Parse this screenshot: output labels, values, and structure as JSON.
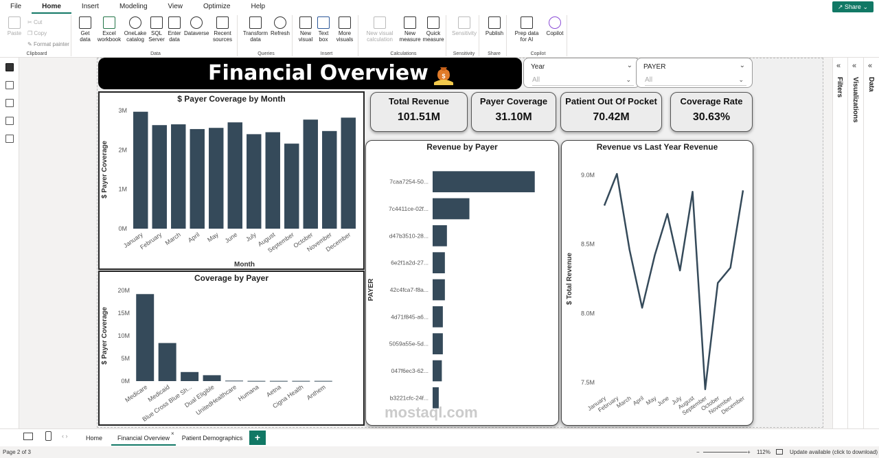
{
  "ribbon_tabs": [
    "File",
    "Home",
    "Insert",
    "Modeling",
    "View",
    "Optimize",
    "Help"
  ],
  "share_label": "Share",
  "ribbon": {
    "clipboard": {
      "paste": "Paste",
      "cut": "Cut",
      "copy": "Copy",
      "format_painter": "Format painter",
      "label": "Clipboard"
    },
    "data": {
      "get_data": "Get data",
      "excel": "Excel workbook",
      "onelake": "OneLake catalog",
      "sql": "SQL Server",
      "enter": "Enter data",
      "dataverse": "Dataverse",
      "recent": "Recent sources",
      "label": "Data"
    },
    "queries": {
      "transform": "Transform data",
      "refresh": "Refresh",
      "label": "Queries"
    },
    "insert": {
      "new_visual": "New visual",
      "text_box": "Text box",
      "more_visuals": "More visuals",
      "label": "Insert"
    },
    "calculations": {
      "new_visual_calc": "New visual calculation",
      "new_measure": "New measure",
      "quick_measure": "Quick measure",
      "label": "Calculations"
    },
    "sensitivity": {
      "sensitivity": "Sensitivity",
      "label": "Sensitivity"
    },
    "share": {
      "publish": "Publish",
      "label": "Share"
    },
    "copilot": {
      "prep_data": "Prep data for AI",
      "copilot": "Copilot",
      "label": "Copilot"
    }
  },
  "panes": {
    "filters": "Filters",
    "visualizations": "Visualizations",
    "data": "Data"
  },
  "report": {
    "title": "Financial Overview",
    "slicers": [
      {
        "title": "Year",
        "value": "All"
      },
      {
        "title": "PAYER",
        "value": "All"
      }
    ],
    "cards": [
      {
        "title": "Total Revenue",
        "value": "101.51M"
      },
      {
        "title": "Payer Coverage",
        "value": "31.10M"
      },
      {
        "title": "Patient Out Of Pocket",
        "value": "70.42M"
      },
      {
        "title": "Coverage Rate",
        "value": "30.63%"
      }
    ]
  },
  "chart_data": [
    {
      "type": "bar",
      "title": "$ Payer Coverage by Month",
      "xlabel": "Month",
      "ylabel": "$ Payer Coverage",
      "yticks": [
        "0M",
        "1M",
        "2M",
        "3M"
      ],
      "ylim": [
        0,
        3
      ],
      "categories": [
        "January",
        "February",
        "March",
        "April",
        "May",
        "June",
        "July",
        "August",
        "September",
        "October",
        "November",
        "December"
      ],
      "values": [
        2.97,
        2.63,
        2.65,
        2.53,
        2.56,
        2.7,
        2.4,
        2.45,
        2.16,
        2.77,
        2.48,
        2.82
      ],
      "color": "#354a5a"
    },
    {
      "type": "bar",
      "title": "Coverage by Payer",
      "ylabel": "$ Payer Coverage",
      "yticks": [
        "0M",
        "5M",
        "10M",
        "15M",
        "20M"
      ],
      "ylim": [
        0,
        20
      ],
      "categories": [
        "Medicare",
        "Medicaid",
        "Blue Cross Blue Sh...",
        "Dual Eligible",
        "UnitedHealthcare",
        "Humana",
        "Aetna",
        "Cigna Health",
        "Anthem"
      ],
      "values": [
        19.2,
        8.4,
        2.0,
        1.3,
        0.1,
        0.05,
        0.05,
        0.05,
        0.05
      ],
      "color": "#354a5a"
    },
    {
      "type": "bar",
      "orientation": "horizontal",
      "title": "Revenue by Payer",
      "ylabel": "PAYER",
      "categories": [
        "7caa7254-50...",
        "7c4411ce-02f...",
        "d47b3510-28...",
        "6e2f1a2d-27...",
        "42c4fca7-f8a...",
        "4d71f845-a6...",
        "5059a55e-5d...",
        "047f6ec3-62...",
        "b3221cfc-24f..."
      ],
      "values": [
        100,
        36,
        14,
        12,
        12,
        10,
        10,
        9,
        6
      ],
      "color": "#354a5a"
    },
    {
      "type": "line",
      "title": "Revenue vs Last Year Revenue",
      "ylabel": "$ Total Revenue",
      "yticks": [
        "7.5M",
        "8.0M",
        "8.5M",
        "9.0M"
      ],
      "ylim": [
        7.4,
        9.1
      ],
      "categories": [
        "January",
        "February",
        "March",
        "April",
        "May",
        "June",
        "July",
        "August",
        "September",
        "October",
        "November",
        "December"
      ],
      "values": [
        8.78,
        9.01,
        8.46,
        8.04,
        8.42,
        8.72,
        8.31,
        8.88,
        7.45,
        8.22,
        8.33,
        8.89
      ],
      "color": "#354a5a"
    }
  ],
  "page_tabs": [
    "Home",
    "Financial Overview",
    "Patient Demographics"
  ],
  "status": {
    "page": "Page 2 of 3",
    "zoom": "112%",
    "update": "Update available (click to download)"
  },
  "watermark": "mostaql.com"
}
